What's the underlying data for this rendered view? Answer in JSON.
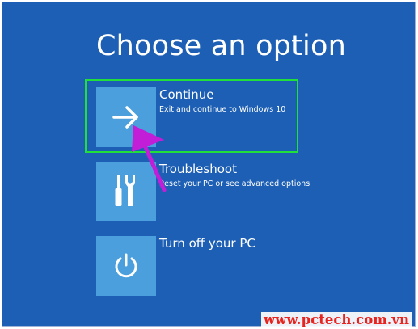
{
  "screen": {
    "title": "Choose an option",
    "background_color": "#1c5fb4",
    "tile_color": "#4a9fdc"
  },
  "options": [
    {
      "title": "Continue",
      "description": "Exit and continue to Windows 10",
      "icon": "arrow-right-icon"
    },
    {
      "title": "Troubleshoot",
      "description": "Reset your PC or see advanced options",
      "icon": "tools-icon"
    },
    {
      "title": "Turn off your PC",
      "description": "",
      "icon": "power-icon"
    }
  ],
  "annotations": {
    "highlight_color": "#22e03a",
    "pointer_color": "#c21ed8",
    "watermark": "www.pctech.com.vn",
    "watermark_color": "#e8241f"
  }
}
